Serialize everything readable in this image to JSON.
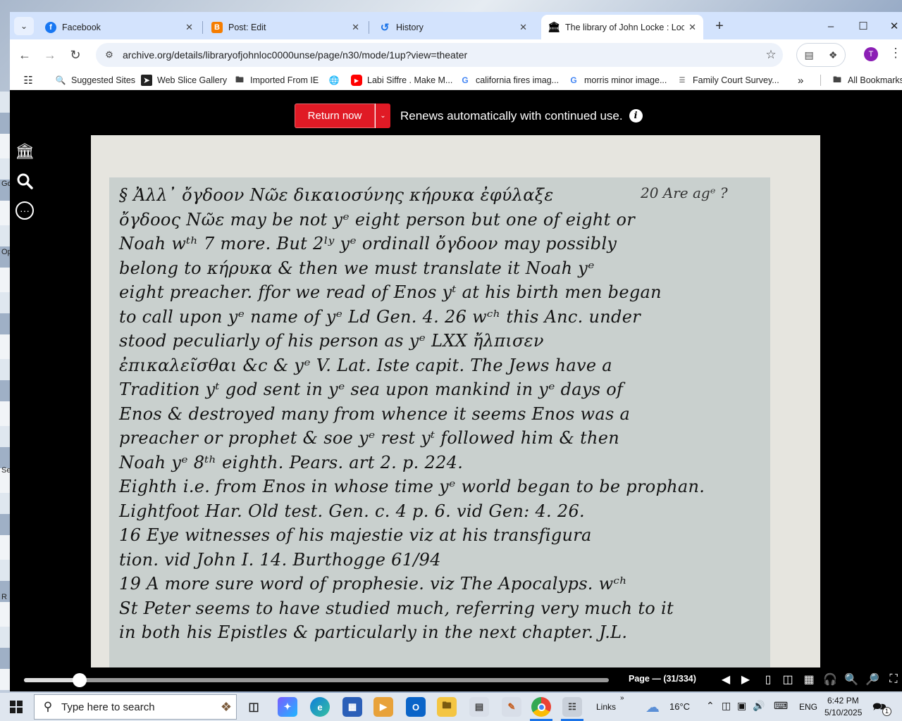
{
  "desktop": {
    "edge_labels": [
      "Go",
      "Op",
      "Se",
      "R"
    ]
  },
  "tabs": [
    {
      "title": "Facebook",
      "favicon": "facebook-icon",
      "color": "#1877f2"
    },
    {
      "title": "Post: Edit",
      "favicon": "blogger-icon",
      "color": "#f57d00"
    },
    {
      "title": "History",
      "favicon": "history-icon",
      "color": "#1a73e8"
    },
    {
      "title": "The library of John Locke : Lock",
      "favicon": "archive-icon",
      "color": "#000000"
    }
  ],
  "address_bar": {
    "url": "archive.org/details/libraryofjohnloc0000unse/page/n30/mode/1up?view=theater"
  },
  "profile": {
    "initial": "T",
    "color": "#8b1fb5"
  },
  "bookmarks": [
    {
      "label": "Suggested Sites",
      "icon": "suggested-sites-icon"
    },
    {
      "label": "Web Slice Gallery",
      "icon": "web-slice-icon"
    },
    {
      "label": "Imported From IE",
      "icon": "folder-icon"
    },
    {
      "label": "",
      "icon": "globe-icon"
    },
    {
      "label": "Labi Siffre . Make M...",
      "icon": "youtube-icon"
    },
    {
      "label": "california fires imag...",
      "icon": "google-icon"
    },
    {
      "label": "morris minor image...",
      "icon": "google-icon"
    },
    {
      "label": "Family Court Survey...",
      "icon": "survey-icon"
    }
  ],
  "all_bookmarks": "All Bookmarks",
  "loan": {
    "return_label": "Return now",
    "renew_text": "Renews automatically with continued use."
  },
  "manuscript": {
    "lines": [
      "§ Ἀλλ᾽ ὄγδοον Νῶε δικαιοσύνης κήρυκα ἐφύλαξε",
      "ὄγδοος Nῶε may be not yᵉ eight person but one of eight or",
      "Noah wᵗʰ 7 more. But 2ˡʸ yᵉ ordinall ὄγδοον may possibly",
      "belong to κήρυκα & then we must translate it Noah yᵉ",
      "eight preacher. ffor we read of Enos yᵗ at his birth men began",
      "to call upon yᵉ name of yᵉ Ld Gen. 4. 26 wᶜʰ this Anc. under",
      "stood peculiarly of his person as yᵉ LXX ἤλπισεν",
      "ἐπικαλεῖσθαι &c & yᵉ V. Lat. Iste capit. The Jews have a",
      "Tradition yᵗ god sent in yᵉ sea upon mankind in yᵉ days of",
      "Enos & destroyed many from whence it seems Enos was a",
      "preacher or prophet & soe yᵉ rest yᵗ followed him & then",
      "Noah yᵉ 8ᵗʰ eighth. Pears. art 2. p. 224.",
      "Eighth i.e. from Enos in whose time yᵉ world began to be prophan.",
      "Lightfoot Har. Old test. Gen. c. 4 p. 6. vid Gen: 4. 26.",
      "16   Eye witnesses of his majestie viz at his transfigura",
      "tion. vid John I. 14. Burthogge 61/94",
      "19   A more sure word of prophesie. viz The Apocalyps. wᶜʰ",
      "St Peter seems to have studied much, referring very much to it",
      "in both his Epistles & particularly in the next chapter. J.L."
    ],
    "margin_note": "20 Are agᵉ ?"
  },
  "viewer": {
    "page_label": "Page — (31/334)",
    "progress": 0.095
  },
  "taskbar": {
    "search_placeholder": "Type here to search",
    "links_label": "Links",
    "temperature": "16°C",
    "language": "ENG",
    "time": "6:42 PM",
    "date": "5/10/2025",
    "notification_count": "1"
  }
}
